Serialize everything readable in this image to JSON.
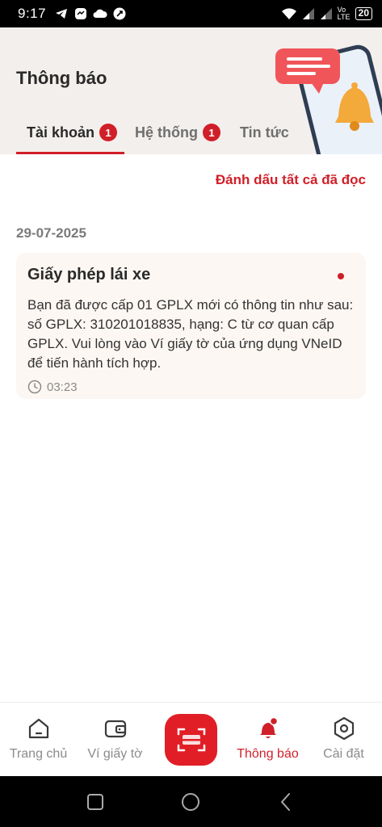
{
  "status_bar": {
    "time": "9:17",
    "network_label": "Vo LTE",
    "battery": "20"
  },
  "header": {
    "title": "Thông báo",
    "tabs": [
      {
        "label": "Tài khoản",
        "badge": "1",
        "active": true
      },
      {
        "label": "Hệ thống",
        "badge": "1",
        "active": false
      },
      {
        "label": "Tin tức",
        "badge": "",
        "active": false
      }
    ]
  },
  "actions": {
    "mark_all_read": "Đánh dấu tất cả đã đọc"
  },
  "notifications": {
    "date": "29-07-2025",
    "items": [
      {
        "title": "Giấy phép lái xe",
        "body": "Bạn đã được cấp 01 GPLX mới có thông tin như sau: số GPLX: 310201018835, hạng: C từ cơ quan cấp GPLX. Vui lòng vào Ví giấy tờ của ứng dụng VNeID để tiến hành tích hợp.",
        "time": "03:23",
        "unread": true
      }
    ]
  },
  "bottom_nav": {
    "items": [
      {
        "label": "Trang chủ",
        "icon": "home-icon"
      },
      {
        "label": "Ví giấy tờ",
        "icon": "wallet-icon"
      },
      {
        "label": "",
        "icon": "scan-icon"
      },
      {
        "label": "Thông báo",
        "icon": "bell-icon",
        "active": true
      },
      {
        "label": "Cài đặt",
        "icon": "settings-icon"
      }
    ]
  },
  "colors": {
    "accent": "#d01f28",
    "header_bg": "#f3efec",
    "card_bg": "#fcf7f3"
  }
}
